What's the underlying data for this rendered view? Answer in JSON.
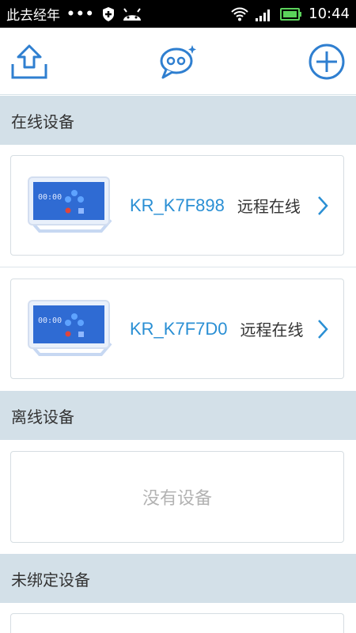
{
  "status_bar": {
    "carrier": "此去经年",
    "dots": "•••",
    "time": "10:44"
  },
  "topbar": {
    "upload_icon": "upload-icon",
    "chat_icon": "chat-bubble-icon",
    "add_icon": "add-circle-icon"
  },
  "sections": {
    "online": "在线设备",
    "offline": "离线设备",
    "unbound": "未绑定设备"
  },
  "devices": [
    {
      "name": "KR_K7F898",
      "status": "远程在线",
      "screen_time": "00:00"
    },
    {
      "name": "KR_K7F7D0",
      "status": "远程在线",
      "screen_time": "00:00"
    }
  ],
  "offline_empty": "没有设备",
  "colors": {
    "accent": "#2a8fd4",
    "section_bg": "#d3e0e8",
    "icon_blue": "#2f7fd0"
  }
}
